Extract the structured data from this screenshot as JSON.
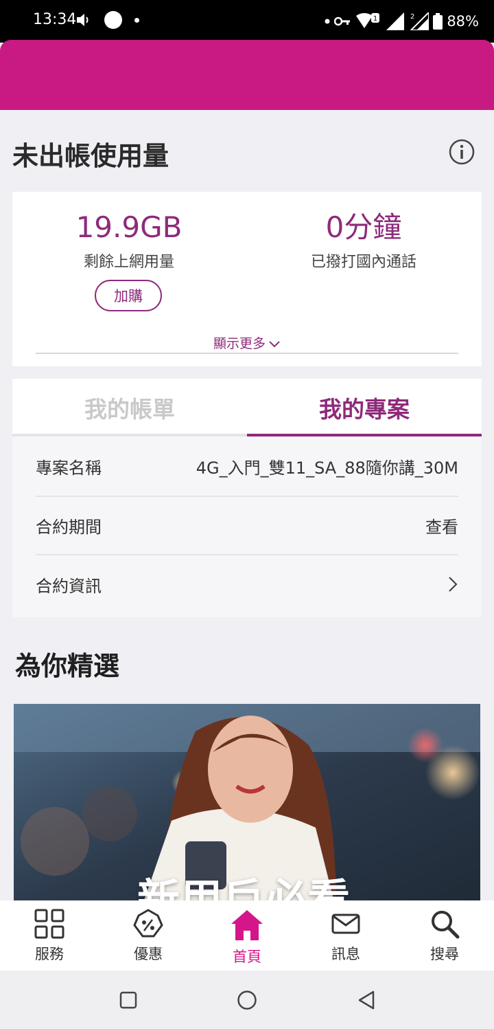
{
  "status_bar": {
    "time": "13:34",
    "battery": "88%"
  },
  "unbilled": {
    "title": "未出帳使用量",
    "data_remaining": {
      "value": "19.9GB",
      "label": "剩餘上網用量"
    },
    "calls": {
      "value": "0分鐘",
      "label": "已撥打國內通話"
    },
    "buy_label": "加購",
    "show_more_label": "顯示更多"
  },
  "tabs": {
    "bill": "我的帳單",
    "plan": "我的專案"
  },
  "plan": {
    "rows": [
      {
        "label": "專案名稱",
        "value": "4G_入門_雙11_SA_88隨你講_30M"
      },
      {
        "label": "合約期間",
        "value": "查看"
      },
      {
        "label": "合約資訊",
        "value": ""
      }
    ]
  },
  "picks": {
    "title": "為你精選",
    "banner_text": "新用戶必看"
  },
  "bottom_nav": [
    {
      "label": "服務",
      "icon": "grid-icon"
    },
    {
      "label": "優惠",
      "icon": "discount-tag-icon"
    },
    {
      "label": "首頁",
      "icon": "home-icon",
      "active": true
    },
    {
      "label": "訊息",
      "icon": "mail-icon"
    },
    {
      "label": "搜尋",
      "icon": "search-icon"
    }
  ],
  "colors": {
    "brand": "#c81a82",
    "accent": "#8e2a7a",
    "active_nav": "#d4168a"
  }
}
